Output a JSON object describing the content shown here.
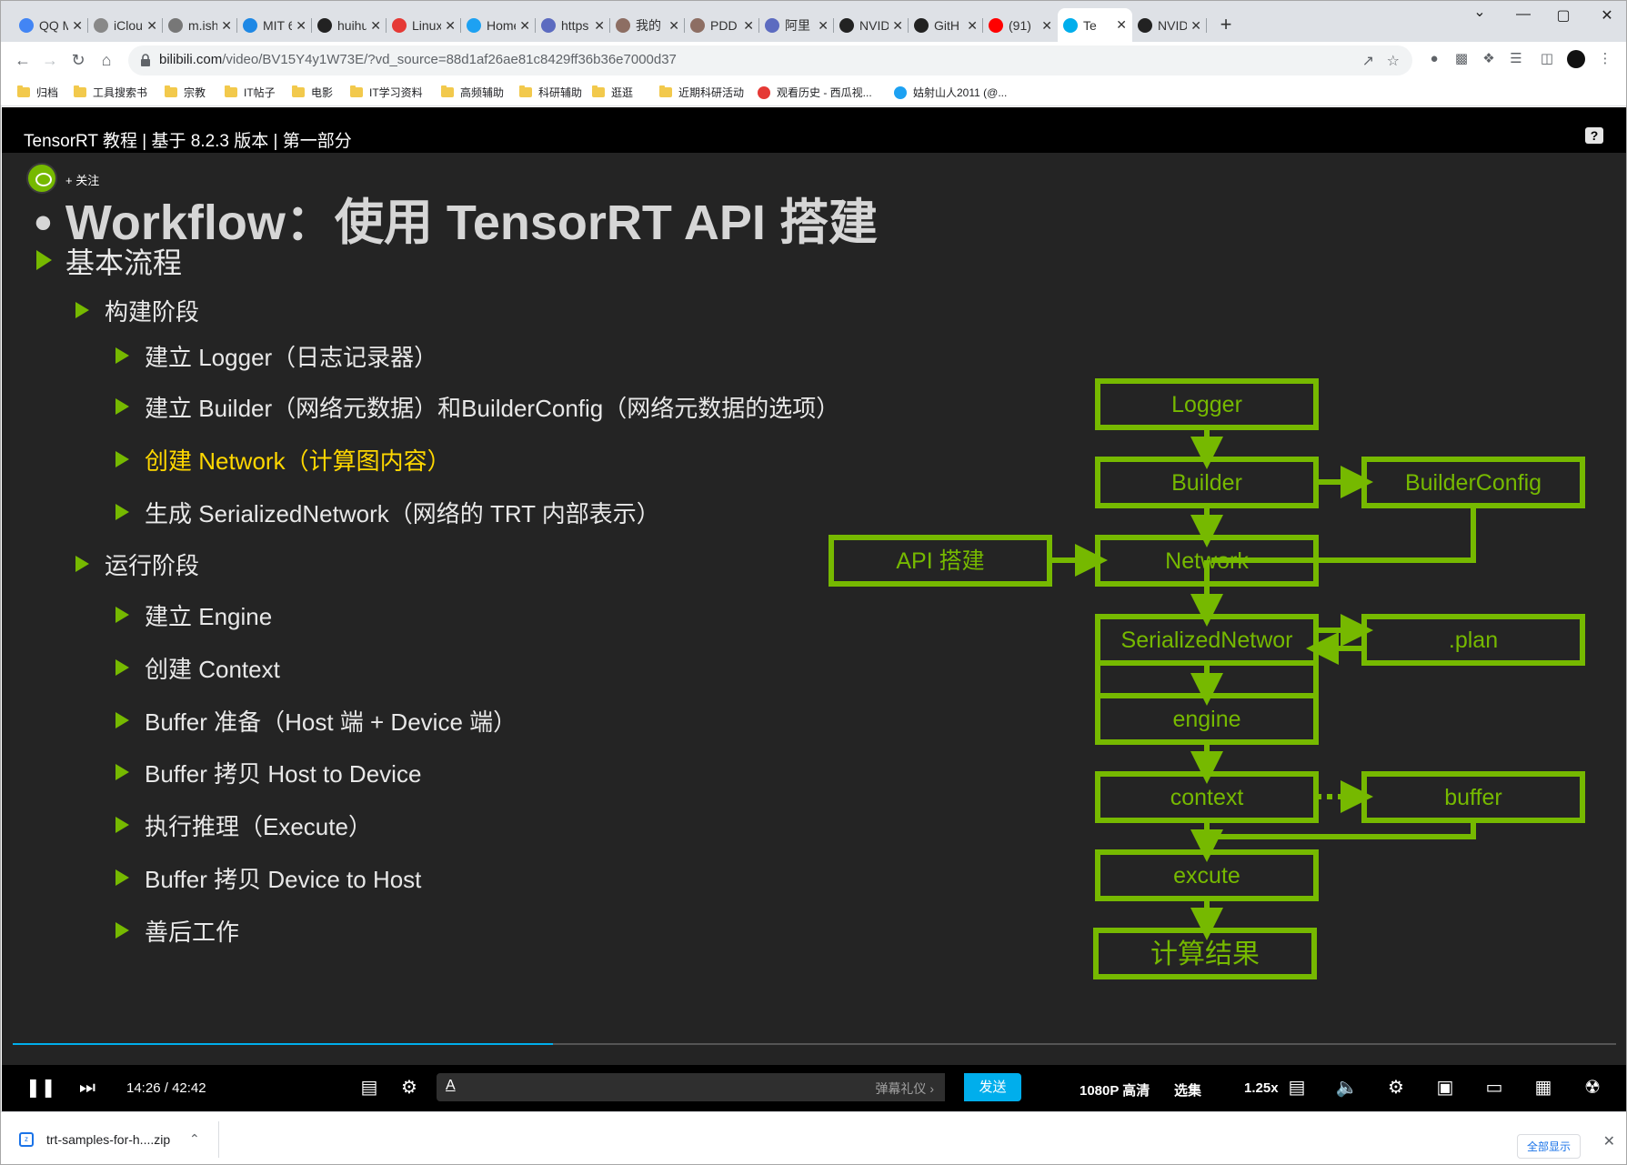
{
  "browser": {
    "tabs": [
      {
        "label": "QQ M",
        "icon": "chrome-icon",
        "color": "#4285f4"
      },
      {
        "label": "iClou",
        "icon": "apple-icon",
        "color": "#888888"
      },
      {
        "label": "m.ish",
        "icon": "globe-icon",
        "color": "#777777"
      },
      {
        "label": "MIT 6",
        "icon": "site-icon",
        "color": "#1e88e5"
      },
      {
        "label": "huihu",
        "icon": "github-icon",
        "color": "#222222"
      },
      {
        "label": "Linux",
        "icon": "site-icon",
        "color": "#e53935"
      },
      {
        "label": "Home",
        "icon": "twitter-icon",
        "color": "#1da1f2"
      },
      {
        "label": "https",
        "icon": "site-icon",
        "color": "#5c6bc0"
      },
      {
        "label": "我的",
        "icon": "site-icon",
        "color": "#8d6e63"
      },
      {
        "label": "PDD",
        "icon": "site-icon",
        "color": "#8d6e63"
      },
      {
        "label": "阿里",
        "icon": "site-icon",
        "color": "#5c6bc0"
      },
      {
        "label": "NVID",
        "icon": "github-icon",
        "color": "#222222"
      },
      {
        "label": "GitH",
        "icon": "github-icon",
        "color": "#222222"
      },
      {
        "label": "(91)",
        "icon": "youtube-icon",
        "color": "#ff0000"
      },
      {
        "label": "Te",
        "icon": "bilibili-icon",
        "color": "#00aeec"
      },
      {
        "label": "NVID",
        "icon": "github-icon",
        "color": "#222222"
      }
    ],
    "url_host": "bilibili.com",
    "url_rest": "/video/BV15Y4y1W73E/?vd_source=88d1af26ae81c8429ff36b36e7000d37",
    "bookmarks": [
      {
        "label": "归档",
        "type": "folder"
      },
      {
        "label": "工具搜索书",
        "type": "folder"
      },
      {
        "label": "宗教",
        "type": "folder"
      },
      {
        "label": "IT帖子",
        "type": "folder"
      },
      {
        "label": "电影",
        "type": "folder"
      },
      {
        "label": "IT学习资料",
        "type": "folder"
      },
      {
        "label": "高频辅助",
        "type": "folder"
      },
      {
        "label": "科研辅助",
        "type": "folder"
      },
      {
        "label": "逛逛",
        "type": "folder"
      },
      {
        "label": "近期科研活动",
        "type": "folder"
      },
      {
        "label": "观看历史 - 西瓜视...",
        "type": "site"
      },
      {
        "label": "姑射山人2011 (@...",
        "type": "twitter"
      }
    ]
  },
  "video": {
    "title": "TensorRT 教程 | 基于 8.2.3 版本 | 第一部分",
    "follow_label": "+ 关注",
    "help_label": "?",
    "slide": {
      "title": "• Workflow：使用 TensorRT API 搭建",
      "items": [
        {
          "text": "基本流程",
          "level": 1
        },
        {
          "text": "构建阶段",
          "level": 2
        },
        {
          "text": "建立 Logger（日志记录器）",
          "level": 3
        },
        {
          "text": "建立 Builder（网络元数据）和BuilderConfig（网络元数据的选项）",
          "level": 3
        },
        {
          "text": "创建 Network（计算图内容）",
          "level": 3,
          "highlight": true
        },
        {
          "text": "生成 SerializedNetwork（网络的 TRT 内部表示）",
          "level": 3
        },
        {
          "text": "运行阶段",
          "level": 2
        },
        {
          "text": "建立 Engine",
          "level": 3
        },
        {
          "text": "创建 Context",
          "level": 3
        },
        {
          "text": "Buffer 准备（Host 端 + Device 端）",
          "level": 3
        },
        {
          "text": "Buffer 拷贝 Host to Device",
          "level": 3
        },
        {
          "text": "执行推理（Execute）",
          "level": 3
        },
        {
          "text": "Buffer 拷贝 Device to Host",
          "level": 3
        },
        {
          "text": "善后工作",
          "level": 3
        }
      ],
      "diagram": {
        "color": "#76b900",
        "nodes": {
          "logger": "Logger",
          "builder": "Builder",
          "builderconfig": "BuilderConfig",
          "api": "API 搭建",
          "network": "Network",
          "serialized": "SerializedNetwor",
          "plan": ".plan",
          "engine": "engine",
          "context": "context",
          "buffer": "buffer",
          "excute": "excute",
          "result": "计算结果"
        }
      }
    },
    "progress": 0.337,
    "controls": {
      "time_current": "14:26",
      "time_sep": "/",
      "time_total": "42:42",
      "danmaku_gift": "弹幕礼仪 ›",
      "send_label": "发送",
      "quality": "1080P 高清",
      "episodes": "选集",
      "speed": "1.25x"
    }
  },
  "download": {
    "filename": "trt-samples-for-h....zip",
    "show_all": "全部显示"
  }
}
